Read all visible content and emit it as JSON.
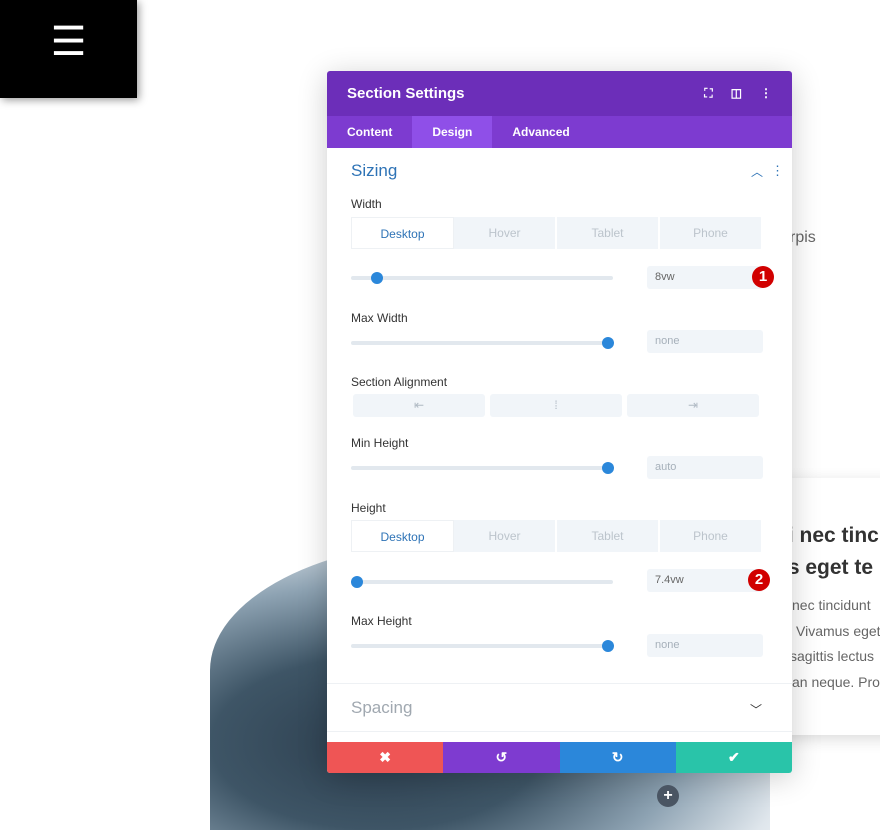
{
  "menu": {
    "icon": "hamburger-icon",
    "glyph": "☰"
  },
  "background": {
    "text_fragment": "rpis",
    "heading_lines": [
      "bi nec tinc",
      "tis eget te"
    ],
    "paragraph_lines": [
      "nec  tincidunt",
      "Vivamus  eget",
      "sagittis  lectus",
      "an neque. Proi"
    ]
  },
  "modal": {
    "title": "Section Settings",
    "header_icons": [
      "fullscreen-icon",
      "split-view-icon",
      "more-vertical-icon"
    ],
    "tabs": [
      {
        "label": "Content"
      },
      {
        "label": "Design",
        "active": true
      },
      {
        "label": "Advanced"
      }
    ],
    "sizing": {
      "title": "Sizing",
      "width": {
        "label": "Width",
        "device_tabs": [
          "Desktop",
          "Hover",
          "Tablet",
          "Phone"
        ],
        "active": "Desktop",
        "value": "8vw",
        "badge": "1"
      },
      "max_width": {
        "label": "Max Width",
        "value": "none"
      },
      "alignment": {
        "label": "Section Alignment",
        "options": [
          "align-left-icon",
          "align-center-icon",
          "align-right-icon"
        ],
        "glyphs": [
          "⇤",
          "⁞",
          "⇥"
        ]
      },
      "min_height": {
        "label": "Min Height",
        "value": "auto"
      },
      "height": {
        "label": "Height",
        "device_tabs": [
          "Desktop",
          "Hover",
          "Tablet",
          "Phone"
        ],
        "active": "Desktop",
        "value": "7.4vw",
        "badge": "2"
      },
      "max_height": {
        "label": "Max Height",
        "value": "none"
      }
    },
    "spacing": {
      "title": "Spacing"
    },
    "footer": {
      "cancel": "✖",
      "undo": "↺",
      "redo": "↻",
      "save": "✔"
    },
    "colors": {
      "header": "#6c2eb9",
      "tabs": "#7d3bd0",
      "cancel": "#ef5555",
      "undo": "#7e3bd0",
      "redo": "#2b87da",
      "save": "#29c4a9"
    }
  },
  "add_button": "+"
}
